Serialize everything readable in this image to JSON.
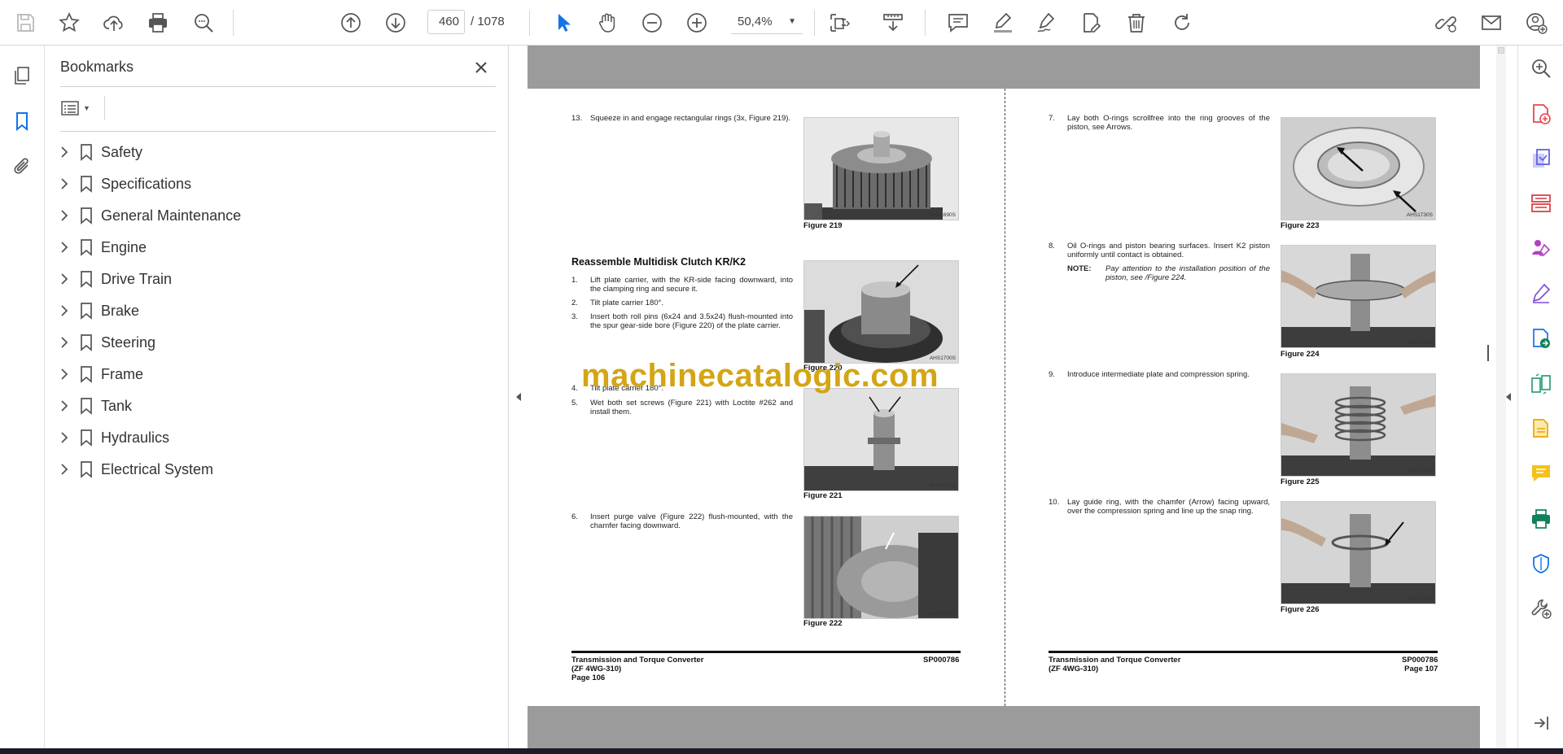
{
  "toolbar": {
    "current_page": "460",
    "page_total": "/  1078",
    "zoom": "50,4%",
    "icons": [
      "save-icon",
      "star-icon",
      "cloud-upload-icon",
      "print-icon",
      "zoom-search-icon",
      "page-up-icon",
      "page-down-icon",
      "select-cursor-icon",
      "hand-icon",
      "zoom-out-icon",
      "zoom-in-icon",
      "fit-page-icon",
      "scroll-mode-icon",
      "comment-icon",
      "highlight-icon",
      "sign-icon",
      "edit-pdf-icon",
      "delete-icon",
      "rotate-icon",
      "share-link-icon",
      "email-icon",
      "account-icon"
    ]
  },
  "bookmarks": {
    "title": "Bookmarks",
    "items": [
      {
        "label": "Safety"
      },
      {
        "label": "Specifications"
      },
      {
        "label": "General Maintenance"
      },
      {
        "label": "Engine"
      },
      {
        "label": "Drive Train"
      },
      {
        "label": "Brake"
      },
      {
        "label": "Steering"
      },
      {
        "label": "Frame"
      },
      {
        "label": "Tank"
      },
      {
        "label": "Hydraulics"
      },
      {
        "label": "Electrical System"
      }
    ]
  },
  "document": {
    "watermark": "machinecatalogic.com",
    "left_page": {
      "steps_top": [
        {
          "num": "13.",
          "text": "Squeeze in and engage rectangular rings (3x, Figure 219)."
        }
      ],
      "section_heading": "Reassemble Multidisk Clutch KR/K2",
      "steps_a": [
        {
          "num": "1.",
          "text": "Lift plate carrier, with the KR-side facing downward, into the clamping ring and secure it."
        },
        {
          "num": "2.",
          "text": "Tilt plate carrier 180°."
        },
        {
          "num": "3.",
          "text": "Insert both roll pins (6x24 and 3.5x24) flush-mounted into the spur gear-side bore (Figure 220) of the plate carrier."
        }
      ],
      "steps_b": [
        {
          "num": "4.",
          "text": "Tilt plate carrier 180°."
        },
        {
          "num": "5.",
          "text": "Wet both set screws (Figure 221) with Loctite #262 and install them."
        }
      ],
      "steps_c": [
        {
          "num": "6.",
          "text": "Insert purge valve (Figure 222) flush-mounted, with the chamfer facing downward."
        }
      ],
      "figures": [
        {
          "caption": "Figure 219",
          "code": "AHS1690S"
        },
        {
          "caption": "Figure 220",
          "code": "AHS1700S"
        },
        {
          "caption": "Figure 221",
          "code": "AHS1710S"
        },
        {
          "caption": "Figure 222",
          "code": "AHS1720S"
        }
      ],
      "footer": {
        "title1": "Transmission and Torque Converter",
        "title2": "(ZF 4WG-310)",
        "page": "Page 106",
        "doc": "SP000786"
      }
    },
    "right_page": {
      "steps": [
        {
          "num": "7.",
          "text": "Lay both O-rings scrollfree into the ring grooves of the piston, see Arrows."
        },
        {
          "num": "8.",
          "text": "Oil O-rings and piston bearing surfaces. Insert K2 piston uniformly until contact is obtained."
        },
        {
          "num": "9.",
          "text": "Introduce intermediate plate and compression spring."
        },
        {
          "num": "10.",
          "text": "Lay guide ring, with the chamfer (Arrow) facing upward, over the compression spring and line up the snap ring."
        }
      ],
      "note_label": "NOTE:",
      "note_text": "Pay attention to the installation position of the piston, see /Figure 224.",
      "figures": [
        {
          "caption": "Figure 223",
          "code": "AHS1730S"
        },
        {
          "caption": "Figure 224",
          "code": "AHS1770S"
        },
        {
          "caption": "Figure 225",
          "code": "AHS1740S"
        },
        {
          "caption": "Figure 226",
          "code": "AHS1750S"
        }
      ],
      "footer": {
        "title1": "Transmission and Torque Converter",
        "title2": "(ZF 4WG-310)",
        "page": "Page 107",
        "doc": "SP000786"
      }
    }
  },
  "right_tools": [
    "zoom-search-icon",
    "export-pdf-icon",
    "create-pdf-icon",
    "organize-pages-icon",
    "fill-sign-icon",
    "edit-icon",
    "convert-icon",
    "compare-icon",
    "scan-icon",
    "comment-icon",
    "print-production-icon",
    "protect-icon",
    "more-tools-icon",
    "expand-icon"
  ],
  "colors": {
    "accent": "#1473e6",
    "tool_red": "#e34850",
    "tool_purple": "#7b4fd4",
    "watermark": "#d4a514",
    "page_gray": "#9b9b9b"
  }
}
